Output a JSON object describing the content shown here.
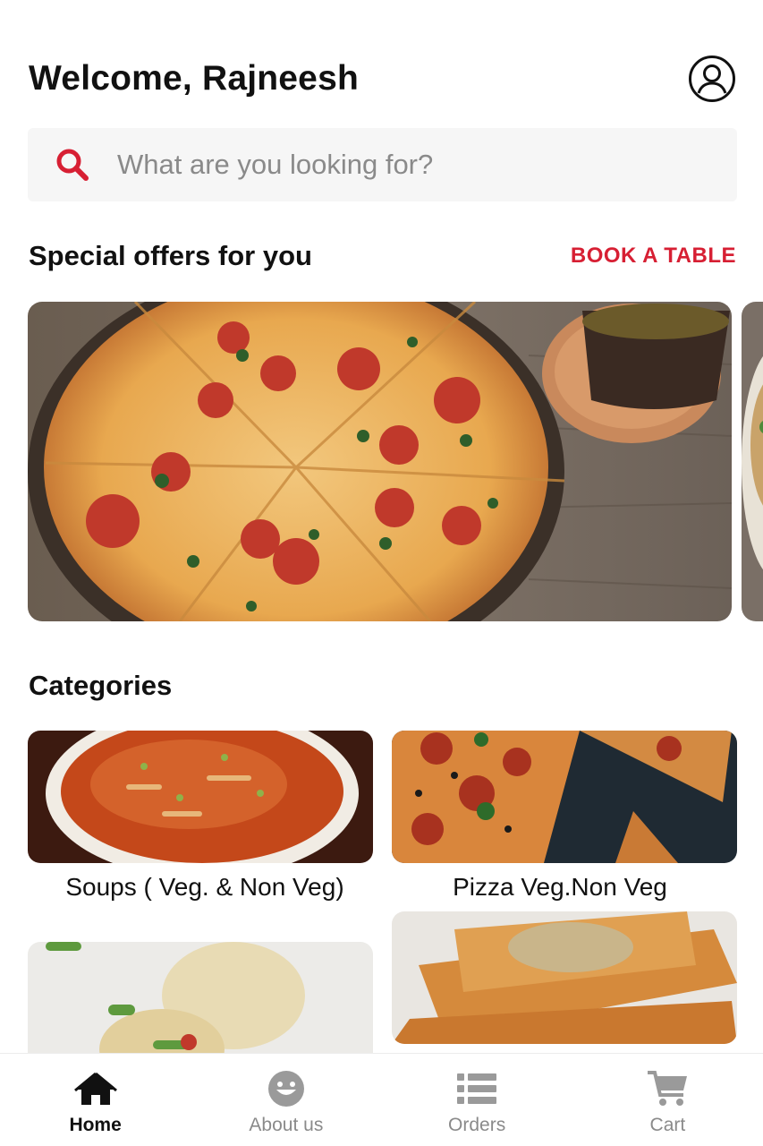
{
  "header": {
    "greeting": "Welcome, Rajneesh"
  },
  "search": {
    "placeholder": "What are you looking for?",
    "value": ""
  },
  "offers": {
    "title": "Special offers for you",
    "action_label": "BOOK A TABLE"
  },
  "categories": {
    "title": "Categories",
    "items": [
      {
        "label": "Soups ( Veg. & Non Veg)"
      },
      {
        "label": "Pizza Veg.Non Veg"
      },
      {
        "label": ""
      },
      {
        "label": ""
      }
    ]
  },
  "bottom_nav": {
    "items": [
      {
        "label": "Home",
        "icon": "home-icon"
      },
      {
        "label": "About us",
        "icon": "smiley-icon"
      },
      {
        "label": "Orders",
        "icon": "list-icon"
      },
      {
        "label": "Cart",
        "icon": "cart-icon"
      }
    ]
  },
  "colors": {
    "accent": "#d71f33",
    "inactive": "#8a8a8a",
    "search_bg": "#f6f6f6"
  }
}
